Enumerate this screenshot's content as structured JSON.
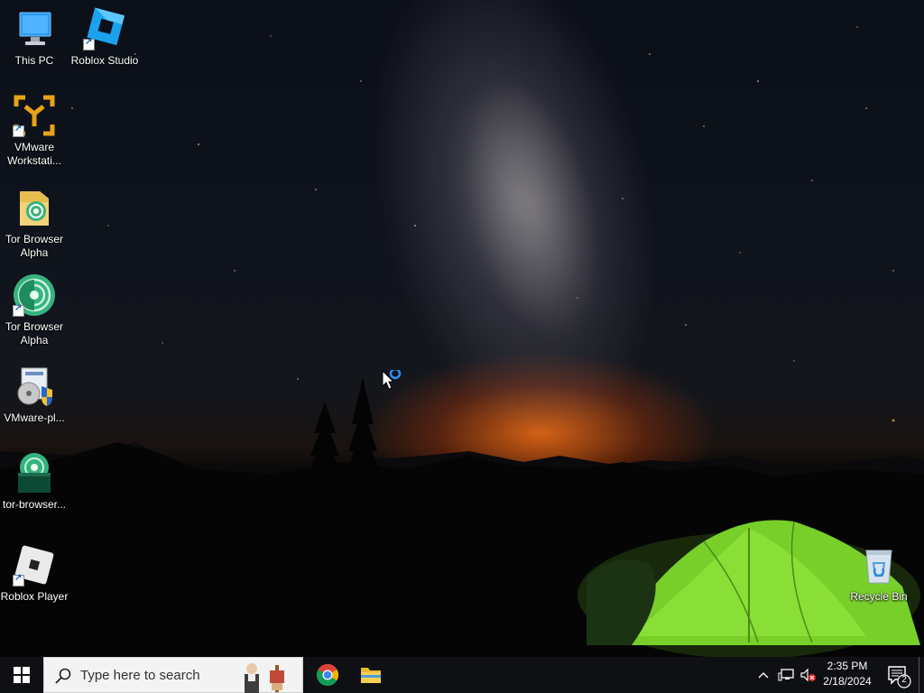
{
  "desktop": {
    "icons": [
      {
        "label": "This PC",
        "icon": "this-pc-icon"
      },
      {
        "label": "Roblox Studio",
        "icon": "roblox-studio-icon"
      },
      {
        "label": "VMware Workstati...",
        "icon": "vmware-workstation-icon"
      },
      {
        "label": "Tor Browser Alpha",
        "icon": "tor-folder-icon"
      },
      {
        "label": "Tor Browser Alpha",
        "icon": "tor-browser-icon"
      },
      {
        "label": "VMware-pl...",
        "icon": "vmware-installer-icon"
      },
      {
        "label": "tor-browser...",
        "icon": "tor-installer-icon"
      },
      {
        "label": "Roblox Player",
        "icon": "roblox-player-icon"
      },
      {
        "label": "Recycle Bin",
        "icon": "recycle-bin-icon"
      }
    ]
  },
  "taskbar": {
    "search_placeholder": "Type here to search",
    "pinned": [
      {
        "name": "Google Chrome",
        "icon": "chrome-icon"
      },
      {
        "name": "File Explorer",
        "icon": "file-explorer-icon"
      }
    ],
    "clock": {
      "time": "2:35 PM",
      "date": "2/18/2024"
    },
    "notification_count": "2"
  },
  "colors": {
    "taskbar": "#0f1014",
    "tent": "#7fd82a",
    "horizon_glow": "#f06a14",
    "accent": "#0078d7"
  }
}
